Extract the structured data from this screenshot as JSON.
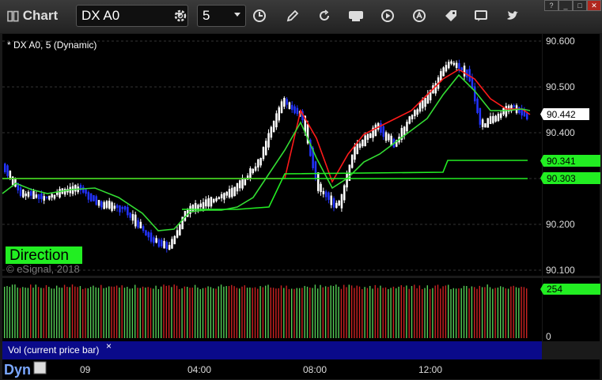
{
  "window": {
    "title": "Chart",
    "help": "?",
    "minimize": "_",
    "maximize": "□",
    "close": "✕"
  },
  "toolbar": {
    "symbol": "DX A0",
    "interval": "5"
  },
  "chart": {
    "header": "* DX A0, 5 (Dynamic)",
    "study_label": "Direction",
    "watermark": "© eSignal, 2018",
    "price_labels": [
      "90.600",
      "90.500",
      "90.400",
      "90.200",
      "90.100"
    ],
    "current_price": "90.442",
    "ma_label_1": "90.341",
    "ma_label_2": "90.303",
    "vol_label": "254",
    "vol_zero": "0",
    "vol_pane_title": "Vol (current price bar)",
    "vol_pane_close": "×",
    "footer_left": "Dyn",
    "time_labels": [
      "09",
      "04:00",
      "08:00",
      "12:00"
    ],
    "colors": {
      "up_candle": "#ffffff",
      "down_candle": "#2233ff",
      "red_ma": "#ff1a1a",
      "green_ma": "#33dd33",
      "direction_bg": "#22ee22"
    }
  }
}
